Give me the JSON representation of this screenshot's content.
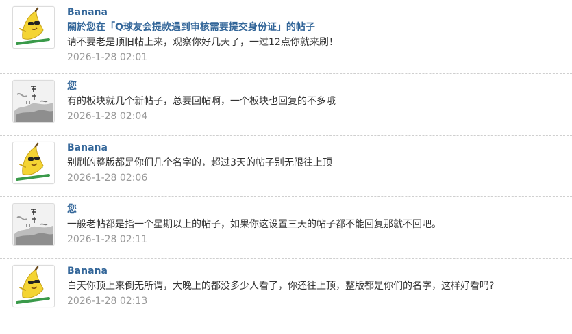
{
  "messages": [
    {
      "author": "Banana",
      "avatar": "banana-avatar-icon",
      "subject": "關於您在「Q球友会提款遇到审核需要提交身份证」的帖子",
      "text": "请不要老是顶旧帖上来，观察你好几天了，一过12点你就来刷！",
      "time": "2026-1-28 02:01"
    },
    {
      "author": "您",
      "avatar": "ink-painting-avatar-icon",
      "text": "有的板块就几个新帖子，总要回帖啊，一个板块也回复的不多哦",
      "time": "2026-1-28 02:04"
    },
    {
      "author": "Banana",
      "avatar": "banana-avatar-icon",
      "text": "别刷的整版都是你们几个名字的，超过3天的帖子别无限往上顶",
      "time": "2026-1-28 02:06"
    },
    {
      "author": "您",
      "avatar": "ink-painting-avatar-icon",
      "text": "一般老帖都是指一个星期以上的帖子，如果你这设置三天的帖子都不能回复那就不回吧。",
      "time": "2026-1-28 02:11"
    },
    {
      "author": "Banana",
      "avatar": "banana-avatar-icon",
      "text": "白天你顶上来倒无所谓，大晚上的都没多少人看了，你还往上顶，整版都是你们的名字，这样好看吗?",
      "time": "2026-1-28 02:13"
    }
  ]
}
